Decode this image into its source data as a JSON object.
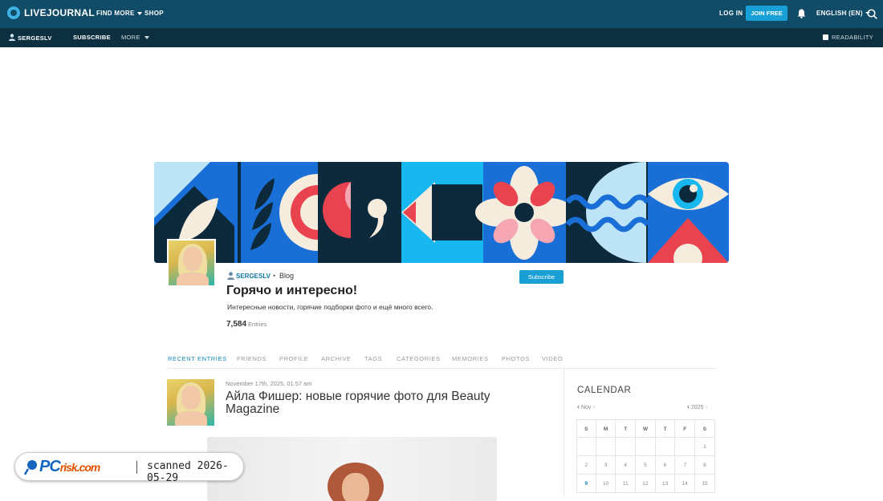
{
  "topbar": {
    "logo": "LIVEJOURNAL",
    "find_more": "FIND MORE",
    "shop": "SHOP",
    "login": "LOG IN",
    "join": "JOIN FREE",
    "language": "ENGLISH (EN)"
  },
  "subbar": {
    "username": "SERGESLV",
    "subscribe": "SUBSCRIBE",
    "more": "MORE",
    "readability": "READABILITY"
  },
  "journal": {
    "username": "SERGESLV",
    "type": "Blog",
    "subscribe": "Subscribe",
    "title": "Горячо и интересно!",
    "subtitle": "Интересные новости, горячие подборки фото и ещё много всего.",
    "entries_count": "7,584",
    "entries_label": "Entries"
  },
  "tabs": [
    "RECENT ENTRIES",
    "FRIENDS",
    "PROFILE",
    "ARCHIVE",
    "TAGS",
    "CATEGORIES",
    "MEMORIES",
    "PHOTOS",
    "VIDEO"
  ],
  "post": {
    "date": "November 17th, 2025, 01:57 am",
    "title": "Айла Фишер: новые горячие фото для Beauty Magazine"
  },
  "calendar": {
    "title": "CALENDAR",
    "month": "Nov",
    "year": "2025",
    "weekdays": [
      "S",
      "M",
      "T",
      "W",
      "T",
      "F",
      "S"
    ],
    "rows": [
      [
        "",
        "",
        "",
        "",
        "",
        "",
        "1"
      ],
      [
        "2",
        "3",
        "4",
        "5",
        "6",
        "7",
        "8"
      ],
      [
        "9",
        "10",
        "11",
        "12",
        "13",
        "14",
        "15"
      ]
    ]
  },
  "watermark": {
    "brand": "PC",
    "brand_suffix": "risk.com",
    "text": "scanned 2026-05-29"
  },
  "colors": {
    "topbar": "#104b67",
    "subbar": "#0c3040",
    "accent": "#1a9fd4",
    "link": "#0f77a6"
  }
}
